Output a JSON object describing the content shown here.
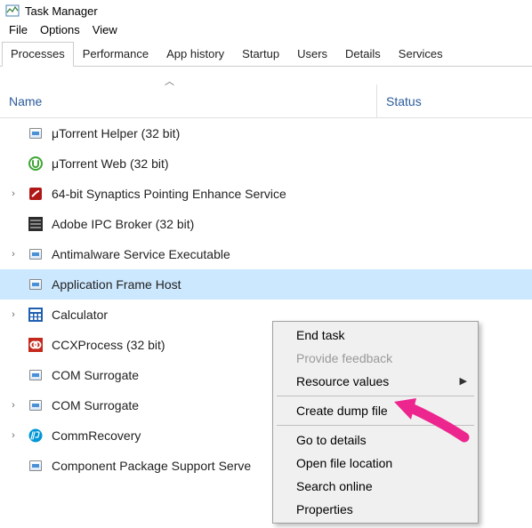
{
  "window": {
    "title": "Task Manager"
  },
  "menubar": {
    "items": [
      "File",
      "Options",
      "View"
    ]
  },
  "tabs": {
    "items": [
      "Processes",
      "Performance",
      "App history",
      "Startup",
      "Users",
      "Details",
      "Services"
    ],
    "active": 0
  },
  "columns": {
    "name": "Name",
    "status": "Status"
  },
  "processes": [
    {
      "name": "μTorrent Helper (32 bit)",
      "expandable": false,
      "icon": "generic-app-icon",
      "selected": false
    },
    {
      "name": "μTorrent Web (32 bit)",
      "expandable": false,
      "icon": "utorrent-icon",
      "selected": false
    },
    {
      "name": "64-bit Synaptics Pointing Enhance Service",
      "expandable": true,
      "icon": "synaptics-icon",
      "selected": false
    },
    {
      "name": "Adobe IPC Broker (32 bit)",
      "expandable": false,
      "icon": "adobe-ipc-icon",
      "selected": false
    },
    {
      "name": "Antimalware Service Executable",
      "expandable": true,
      "icon": "generic-app-icon",
      "selected": false
    },
    {
      "name": "Application Frame Host",
      "expandable": false,
      "icon": "generic-app-icon",
      "selected": true
    },
    {
      "name": "Calculator",
      "expandable": true,
      "icon": "calculator-icon",
      "selected": false
    },
    {
      "name": "CCXProcess (32 bit)",
      "expandable": false,
      "icon": "ccx-icon",
      "selected": false
    },
    {
      "name": "COM Surrogate",
      "expandable": false,
      "icon": "generic-app-icon",
      "selected": false
    },
    {
      "name": "COM Surrogate",
      "expandable": true,
      "icon": "generic-app-icon",
      "selected": false
    },
    {
      "name": "CommRecovery",
      "expandable": true,
      "icon": "hp-icon",
      "selected": false
    },
    {
      "name": "Component Package Support Serve",
      "expandable": false,
      "icon": "generic-app-icon",
      "selected": false
    }
  ],
  "context_menu": {
    "items": [
      {
        "label": "End task",
        "type": "item"
      },
      {
        "label": "Provide feedback",
        "type": "disabled"
      },
      {
        "label": "Resource values",
        "type": "submenu"
      },
      {
        "type": "separator"
      },
      {
        "label": "Create dump file",
        "type": "item"
      },
      {
        "type": "separator"
      },
      {
        "label": "Go to details",
        "type": "item"
      },
      {
        "label": "Open file location",
        "type": "item"
      },
      {
        "label": "Search online",
        "type": "item"
      },
      {
        "label": "Properties",
        "type": "item"
      }
    ]
  },
  "colors": {
    "selection": "#cce8ff",
    "header_text": "#2b5b9c",
    "arrow": "#ec268e"
  }
}
